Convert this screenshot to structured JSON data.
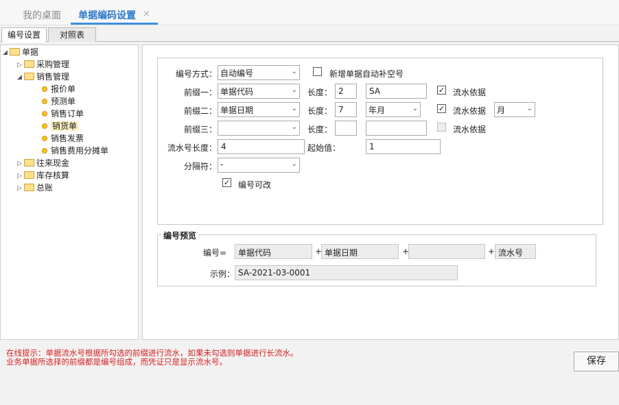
{
  "top_tabs": [
    {
      "label": "我的桌面"
    },
    {
      "label": "单据编码设置",
      "close": "×"
    }
  ],
  "sub_tabs": [
    {
      "label": "编号设置"
    },
    {
      "label": "对照表"
    }
  ],
  "tree": {
    "root": "单据",
    "items": [
      {
        "label": "采购管理"
      },
      {
        "label": "销售管理"
      },
      {
        "label": "报价单"
      },
      {
        "label": "预测单"
      },
      {
        "label": "销售订单"
      },
      {
        "label": "销货单"
      },
      {
        "label": "销售发票"
      },
      {
        "label": "销售费用分摊单"
      },
      {
        "label": "往来现金"
      },
      {
        "label": "库存核算"
      },
      {
        "label": "总账"
      }
    ]
  },
  "form": {
    "numbering_mode_label": "编号方式：",
    "numbering_mode_value": "自动编号",
    "auto_fill_label": "新增单据自动补空号",
    "prefix1_label": "前缀一：",
    "prefix1_value": "单据代码",
    "prefix1_length_label": "长度：",
    "prefix1_length": "2",
    "prefix1_text": "SA",
    "prefix1_serial_label": "流水依据",
    "prefix2_label": "前缀二：",
    "prefix2_value": "单据日期",
    "prefix2_length_label": "长度：",
    "prefix2_length": "7",
    "prefix2_format": "年月",
    "prefix2_serial_label": "流水依据",
    "prefix2_serial_unit": "月",
    "prefix3_label": "前缀三：",
    "prefix3_value": "",
    "prefix3_length_label": "长度：",
    "prefix3_length": "",
    "prefix3_text": "",
    "prefix3_serial_label": "流水依据",
    "serial_length_label": "流水号长度：",
    "serial_length": "4",
    "start_value_label": "起始值：",
    "start_value": "1",
    "separator_label": "分隔符：",
    "separator_value": "-",
    "editable_label": "编号可改",
    "checkmark": "✓"
  },
  "preview": {
    "legend": "编号预览",
    "formula_label": "编号=",
    "part1": "单据代码",
    "part2": "单据日期",
    "part3": "",
    "part4": "流水号",
    "plus": "+",
    "example_label": "示例：",
    "example_value": "SA-2021-03-0001"
  },
  "hint": {
    "line1": "在线提示：单据流水号根据所勾选的前缀进行流水，如果未勾选则单据进行长流水。",
    "line2": "业务单据所选择的前缀都是编号组成，而凭证只是显示流水号。"
  },
  "save_label": "保存",
  "arrow": "⌄",
  "colors": {
    "accent": "#3d8ee0",
    "hint": "#d62020"
  }
}
